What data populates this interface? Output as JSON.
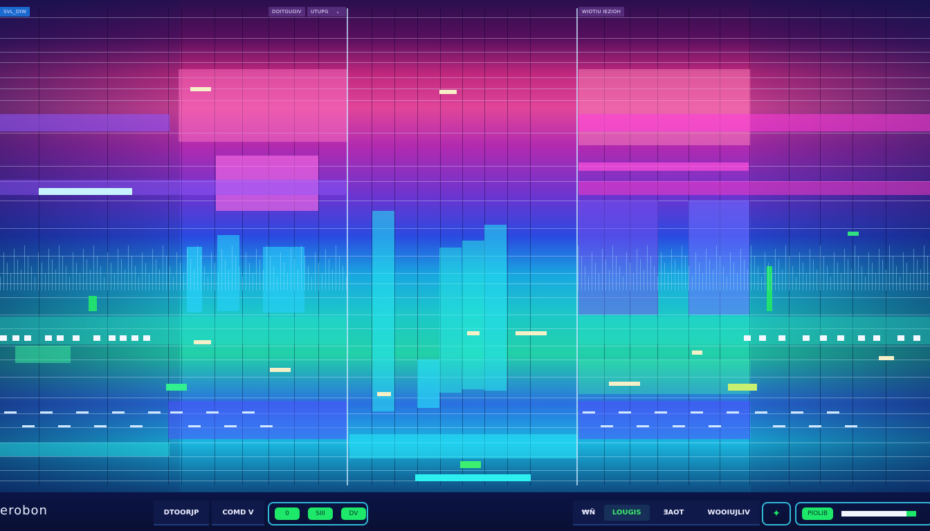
{
  "top_bar": {
    "left_button": "SVL_DIW",
    "mode_label": "DOITGUOIV",
    "select_value": "UTUPG",
    "right_tag": "WIOTIU IEZIOH"
  },
  "bottom_bar": {
    "logo": "erobon",
    "tabs": [
      "DTOORJP",
      "COMD V"
    ],
    "toggle_group": [
      "0",
      "SIII",
      "DV"
    ],
    "right_icon_label": "₩Ñ",
    "right_tabs": [
      "LOUGIS",
      "ƎAOT",
      "WOOIUJLIV"
    ],
    "status_badge": "PIOLIB",
    "progress_percent": 87
  },
  "colors": {
    "accent_green": "#1de86a",
    "accent_cyan": "#2fb8d8",
    "bg_navy": "#0a1238",
    "magenta": "#e0459a"
  },
  "icons": {
    "select": "chevron-down-icon",
    "add": "diamond-plus-icon"
  }
}
